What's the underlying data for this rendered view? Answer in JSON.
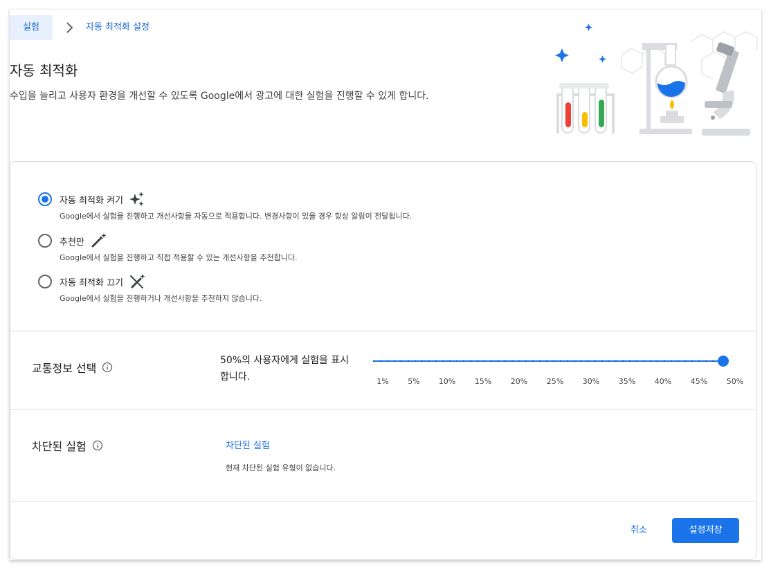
{
  "breadcrumb": {
    "parent": "실험",
    "current": "자동 최적화 설정"
  },
  "header": {
    "title": "자동 최적화",
    "description": "수입을 늘리고 사용자 환경을 개선할 수 있도록 Google에서 광고에 대한 실험을 진행할 수 있게 합니다."
  },
  "options": [
    {
      "label": "자동 최적화 켜기",
      "description": "Google에서 실험을 진행하고 개선사항을 자동으로 적용합니다. 변경사항이 있을 경우 항상 알림이 전달됩니다.",
      "icon": "sparkle-icon",
      "selected": true
    },
    {
      "label": "추천만",
      "description": "Google에서 실험을 진행하고 직접 적용할 수 있는 개선사항을 추천합니다.",
      "icon": "magic-wand-icon",
      "selected": false
    },
    {
      "label": "자동 최적화 끄기",
      "description": "Google에서 실험을 진행하거나 개선사항을 추천하지 않습니다.",
      "icon": "magic-wand-off-icon",
      "selected": false
    }
  ],
  "traffic": {
    "title": "교통정보 선택",
    "summary": "50%의 사용자에게 실험을 표시합니다.",
    "ticks": [
      "1%",
      "5%",
      "10%",
      "15%",
      "20%",
      "25%",
      "30%",
      "35%",
      "40%",
      "45%",
      "50%"
    ],
    "value_percent": 50
  },
  "blocked": {
    "title": "차단된 실험",
    "link": "차단된 실험",
    "description": "현재 차단된 실험 유형이 없습니다."
  },
  "actions": {
    "cancel": "취소",
    "save": "설정저장"
  },
  "colors": {
    "accent": "#1a73e8",
    "chip_bg": "#e8f0fe",
    "divider": "#dadce0"
  }
}
